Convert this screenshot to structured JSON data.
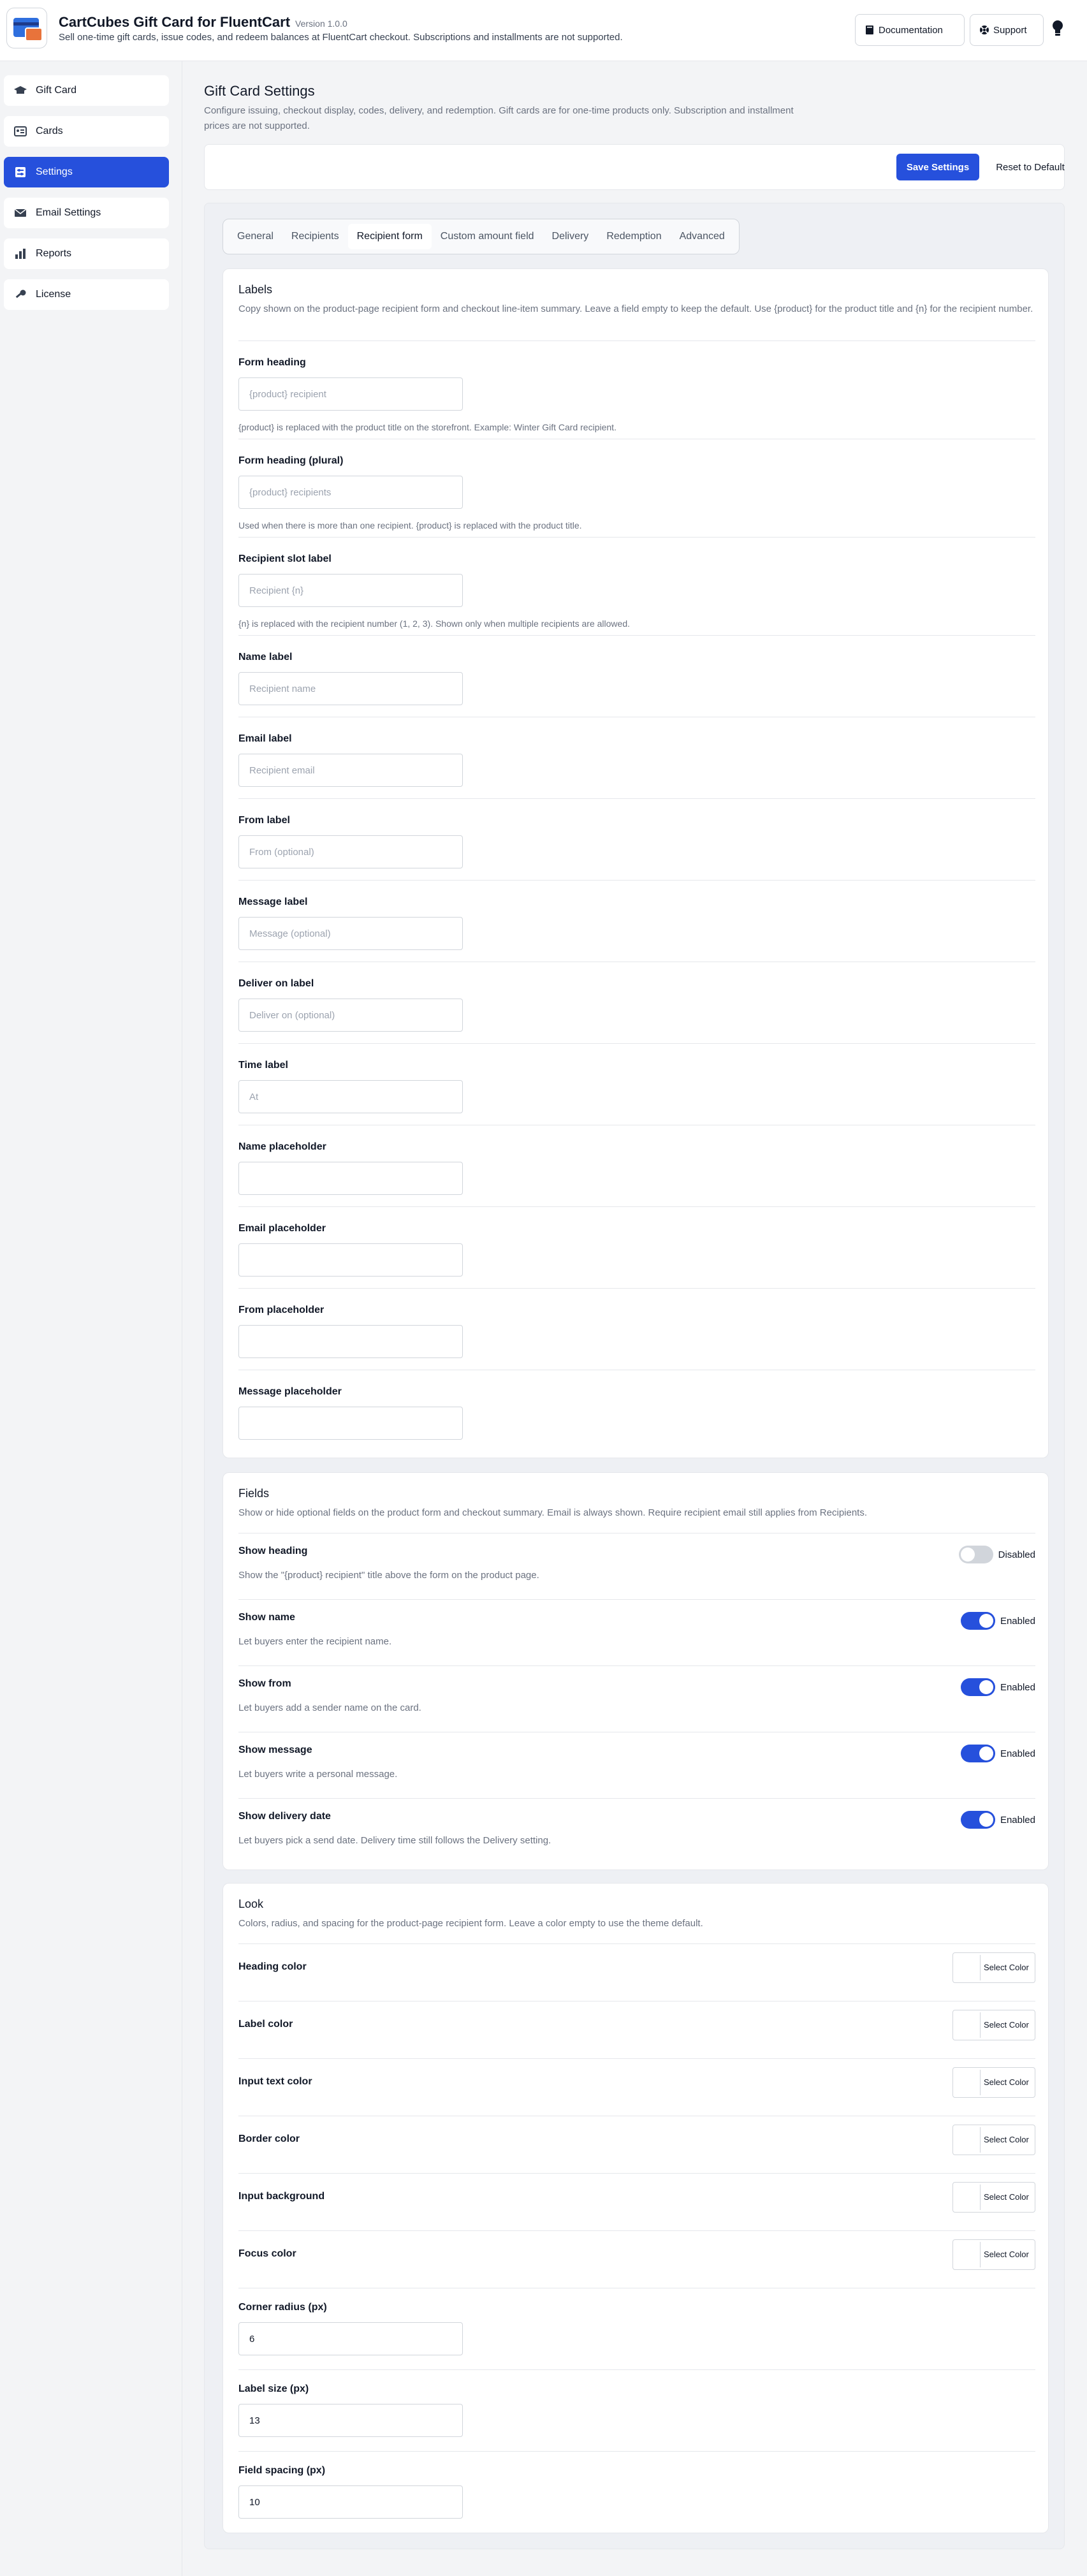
{
  "header": {
    "title": "CartCubes Gift Card for FluentCart",
    "version": "Version 1.0.0",
    "subtitle": "Sell one-time gift cards, issue codes, and redeem balances at FluentCart checkout. Subscriptions and installments are not supported.",
    "doc_label": "Documentation",
    "support_label": "Support"
  },
  "sidebar": {
    "items": [
      {
        "label": "Gift Card",
        "icon": "graduation-cap-icon"
      },
      {
        "label": "Cards",
        "icon": "id-card-icon"
      },
      {
        "label": "Settings",
        "icon": "settings-icon",
        "active": true
      },
      {
        "label": "Email Settings",
        "icon": "envelope-icon"
      },
      {
        "label": "Reports",
        "icon": "bar-chart-icon"
      },
      {
        "label": "License",
        "icon": "key-icon"
      }
    ]
  },
  "page": {
    "title": "Gift Card Settings",
    "description": "Configure issuing, checkout display, codes, delivery, and redemption. Gift cards are for one-time products only. Subscription and installment prices are not supported.",
    "save_label": "Save Settings",
    "reset_label": "Reset to Default"
  },
  "tabs": [
    "General",
    "Recipients",
    "Recipient form",
    "Custom amount field",
    "Delivery",
    "Redemption",
    "Advanced"
  ],
  "labels_section": {
    "title": "Labels",
    "description": "Copy shown on the product-page recipient form and checkout line-item summary. Leave a field empty to keep the default. Use {product} for the product title and {n} for the recipient number.",
    "fields": [
      {
        "label": "Form heading",
        "placeholder": "{product} recipient",
        "value": "",
        "help": "{product} is replaced with the product title on the storefront. Example: Winter Gift Card recipient."
      },
      {
        "label": "Form heading (plural)",
        "placeholder": "{product} recipients",
        "value": "",
        "help": "Used when there is more than one recipient. {product} is replaced with the product title."
      },
      {
        "label": "Recipient slot label",
        "placeholder": "Recipient {n}",
        "value": "",
        "help": "{n} is replaced with the recipient number (1, 2, 3). Shown only when multiple recipients are allowed."
      },
      {
        "label": "Name label",
        "placeholder": "Recipient name",
        "value": ""
      },
      {
        "label": "Email label",
        "placeholder": "Recipient email",
        "value": ""
      },
      {
        "label": "From label",
        "placeholder": "From (optional)",
        "value": ""
      },
      {
        "label": "Message label",
        "placeholder": "Message (optional)",
        "value": ""
      },
      {
        "label": "Deliver on label",
        "placeholder": "Deliver on (optional)",
        "value": ""
      },
      {
        "label": "Time label",
        "placeholder": "At",
        "value": ""
      },
      {
        "label": "Name placeholder",
        "placeholder": "",
        "value": ""
      },
      {
        "label": "Email placeholder",
        "placeholder": "",
        "value": ""
      },
      {
        "label": "From placeholder",
        "placeholder": "",
        "value": ""
      },
      {
        "label": "Message placeholder",
        "placeholder": "",
        "value": ""
      }
    ]
  },
  "fields_section": {
    "title": "Fields",
    "description": "Show or hide optional fields on the product form and checkout summary. Email is always shown. Require recipient email still applies from Recipients.",
    "toggles": [
      {
        "label": "Show heading",
        "help": "Show the \"{product} recipient\" title above the form on the product page.",
        "state": "Disabled",
        "on": false
      },
      {
        "label": "Show name",
        "help": "Let buyers enter the recipient name.",
        "state": "Enabled",
        "on": true
      },
      {
        "label": "Show from",
        "help": "Let buyers add a sender name on the card.",
        "state": "Enabled",
        "on": true
      },
      {
        "label": "Show message",
        "help": "Let buyers write a personal message.",
        "state": "Enabled",
        "on": true
      },
      {
        "label": "Show delivery date",
        "help": "Let buyers pick a send date. Delivery time still follows the Delivery setting.",
        "state": "Enabled",
        "on": true
      }
    ]
  },
  "look_section": {
    "title": "Look",
    "description": "Colors, radius, and spacing for the product-page recipient form. Leave a color empty to use the theme default.",
    "select_color_label": "Select Color",
    "colors": [
      "Heading color",
      "Label color",
      "Input text color",
      "Border color",
      "Input background",
      "Focus color"
    ],
    "numbers": [
      {
        "label": "Corner radius (px)",
        "value": "6"
      },
      {
        "label": "Label size (px)",
        "value": "13"
      },
      {
        "label": "Field spacing (px)",
        "value": "10"
      }
    ]
  },
  "colors": {
    "accent": "#2650dc",
    "brand_orange": "#e8733b"
  }
}
